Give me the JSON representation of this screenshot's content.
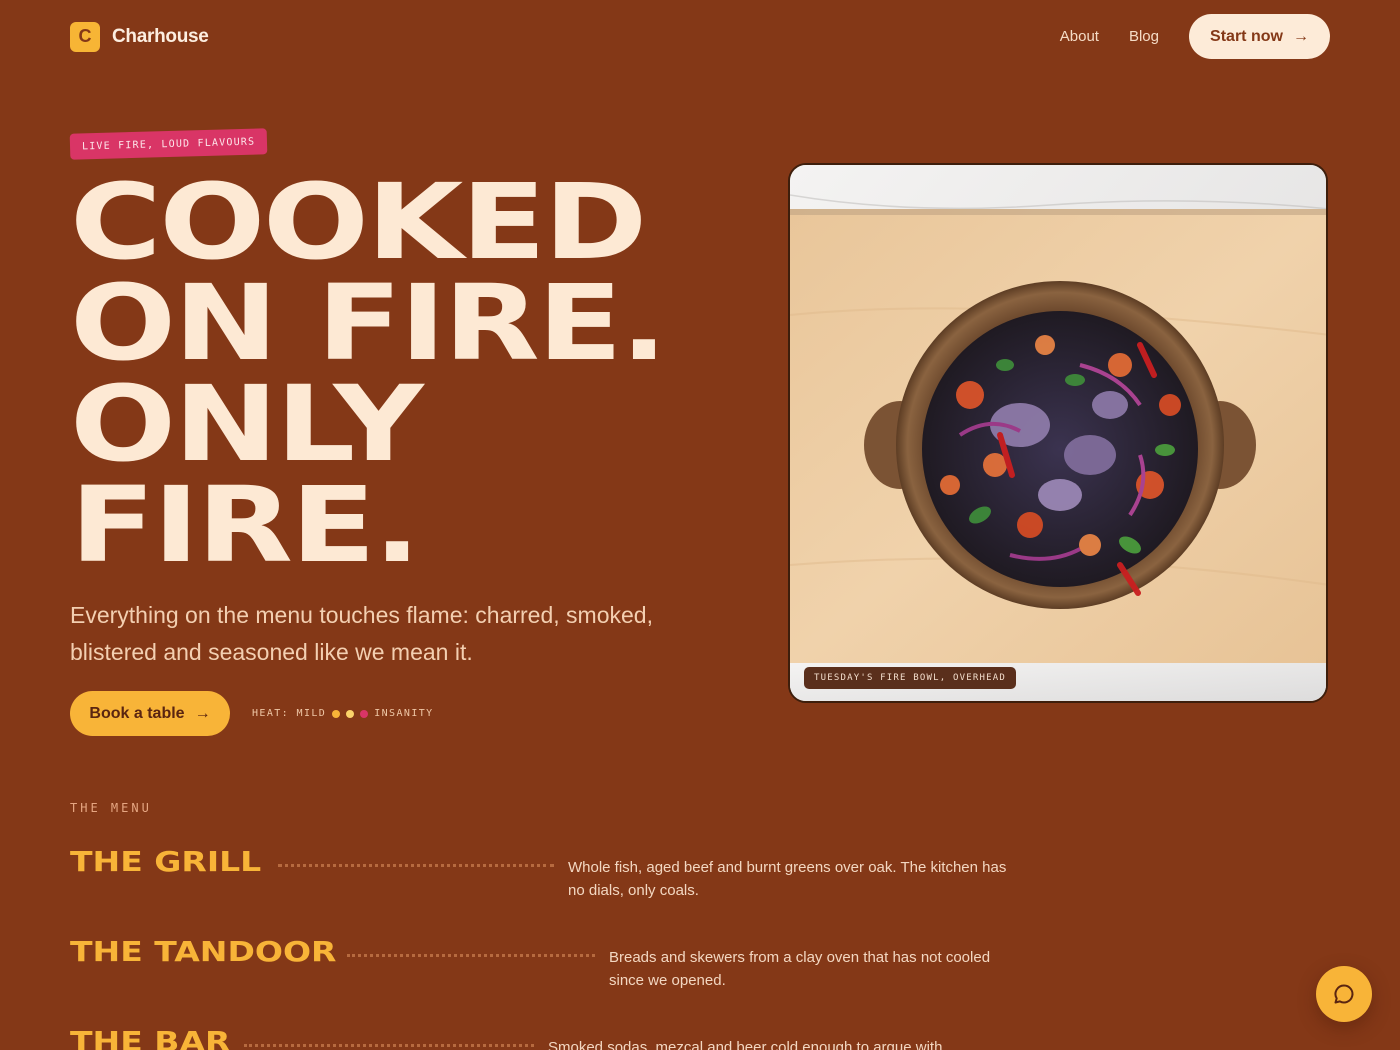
{
  "brand": {
    "logo_letter": "C",
    "name": "Charhouse"
  },
  "nav": {
    "links": [
      "About",
      "Blog"
    ],
    "cta_label": "Start now"
  },
  "hero": {
    "tagline": "LIVE FIRE, LOUD FLAVOURS",
    "headline_lines": [
      "COOKED",
      "ON FIRE.",
      "ONLY",
      "FIRE."
    ],
    "subcopy": "Everything on the menu touches flame: charred, smoked, blistered and seasoned like we mean it.",
    "book_label": "Book a table",
    "heat": {
      "low_label": "HEAT: MILD",
      "high_label": "INSANITY",
      "dot_colors": [
        "#f8b438",
        "#fbd36a",
        "#d93566"
      ]
    }
  },
  "photo": {
    "caption": "TUESDAY'S FIRE BOWL, OVERHEAD"
  },
  "menu": {
    "label": "THE MENU",
    "items": [
      {
        "title": "THE GRILL",
        "description": "Whole fish, aged beef and burnt greens over oak. The kitchen has no dials, only coals."
      },
      {
        "title": "THE TANDOOR",
        "description": "Breads and skewers from a clay oven that has not cooled since we opened."
      },
      {
        "title": "THE BAR",
        "description": "Smoked sodas, mezcal and beer cold enough to argue with."
      }
    ]
  },
  "colors": {
    "background": "#843817",
    "accent": "#f8b438",
    "cream": "#fde9d4",
    "pink": "#d93566"
  },
  "icons": {
    "arrow": "arrow-right-icon",
    "chat": "chat-bubble-icon"
  }
}
